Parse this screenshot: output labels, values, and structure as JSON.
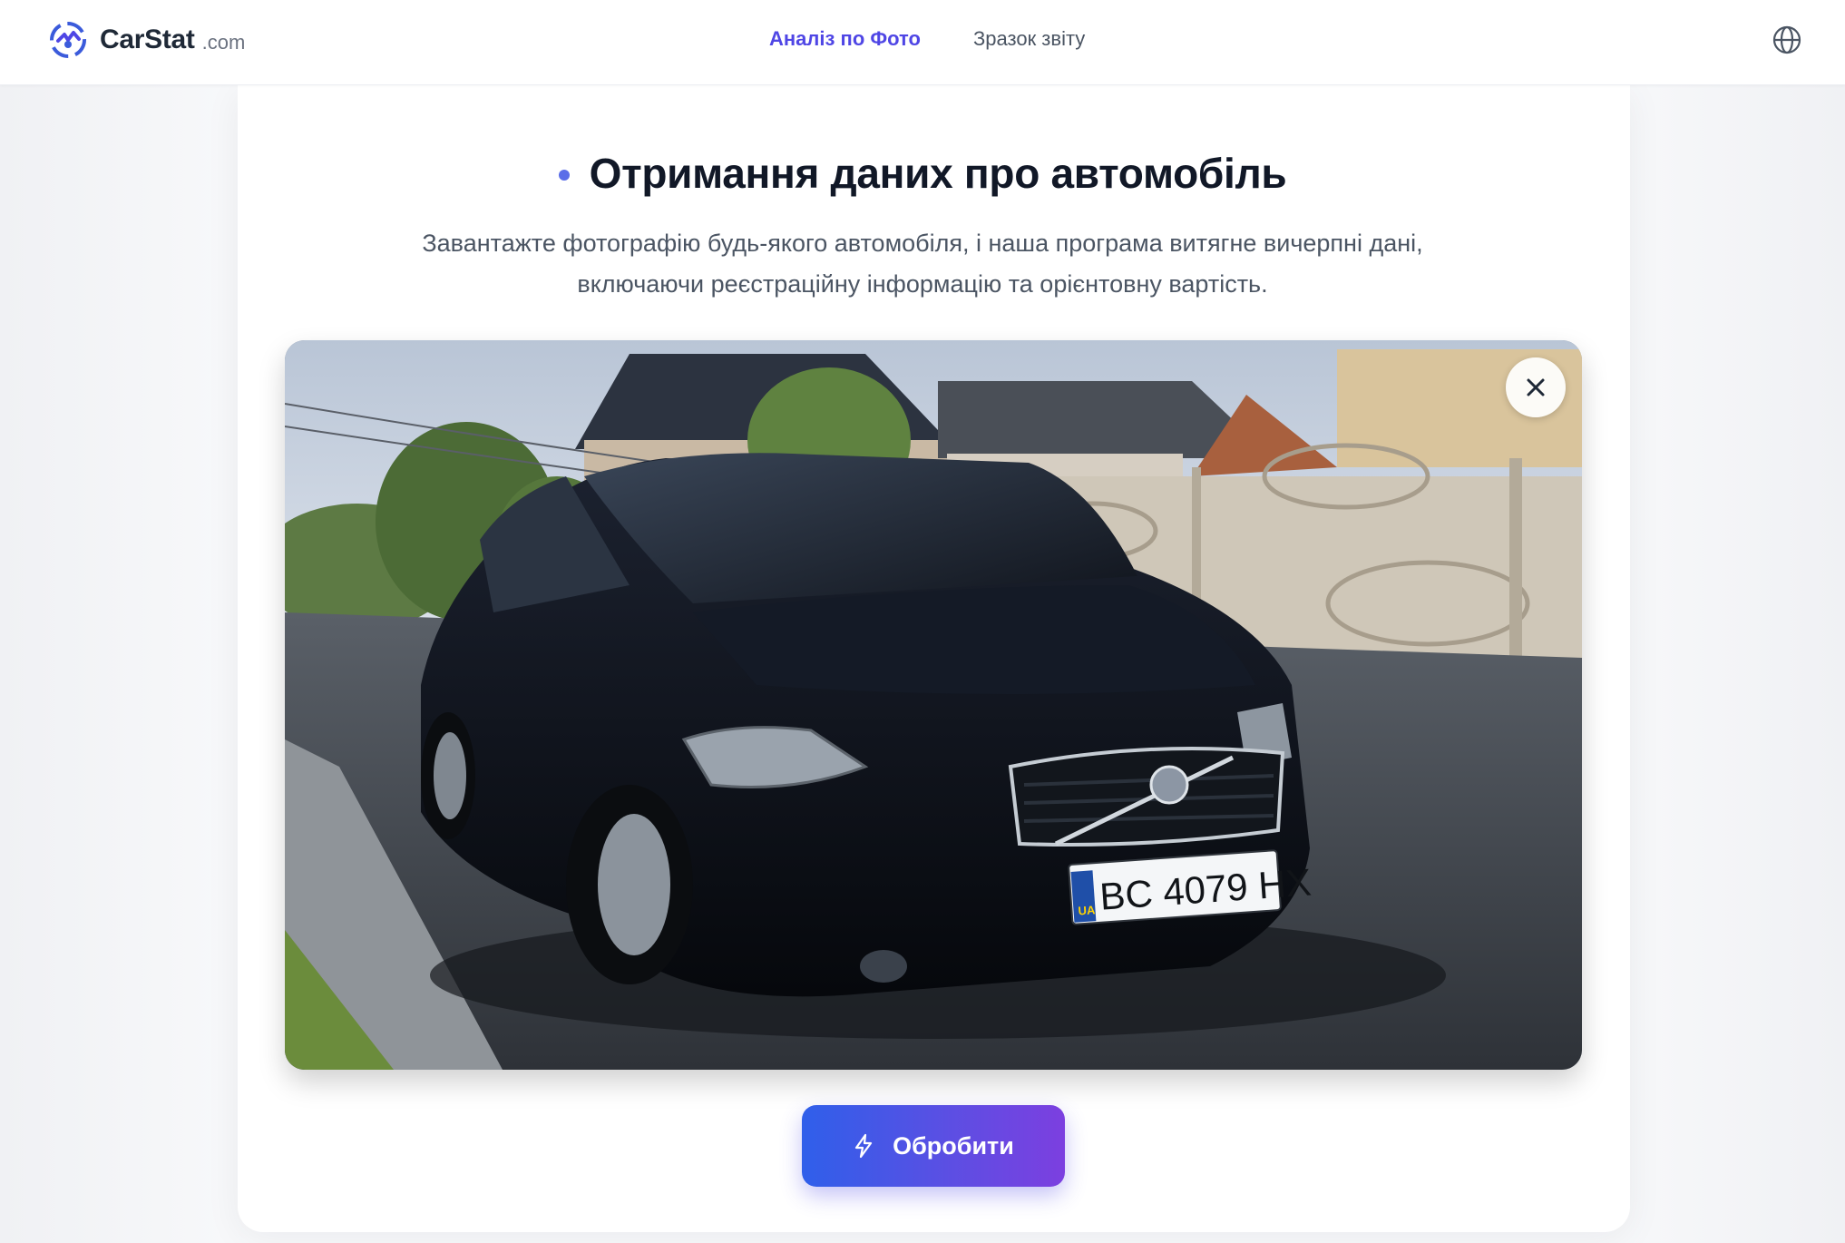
{
  "header": {
    "brand": "CarStat",
    "brand_domain": ".com",
    "nav": [
      {
        "label": "Аналіз по Фото",
        "active": true
      },
      {
        "label": "Зразок звіту",
        "active": false
      }
    ],
    "language_icon": "globe-icon"
  },
  "main": {
    "title": "Отримання даних про автомобіль",
    "subtitle": "Завантажте фотографію будь-якого автомобіля, і наша програма витягне вичерпні дані, включаючи реєстраційну інформацію та орієнтовну вартість.",
    "photo": {
      "plate_country": "UA",
      "plate_number": "BC 4079 HX",
      "remove_icon": "close-icon"
    },
    "process_button": {
      "label": "Обробити",
      "icon": "lightning-icon"
    }
  },
  "colors": {
    "accent": "#4f46e5",
    "button_gradient_start": "#2f5fea",
    "button_gradient_end": "#7c3fe0"
  }
}
